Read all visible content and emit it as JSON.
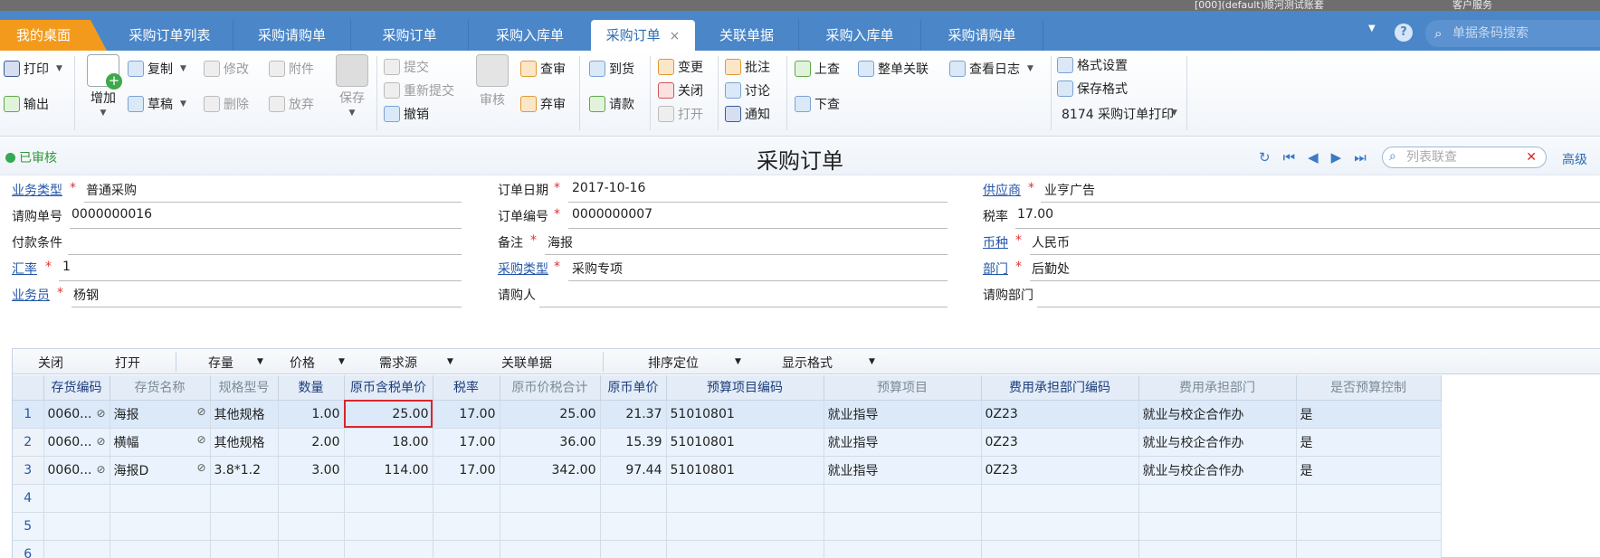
{
  "topbar": {
    "left_text": "[000](default)顺河测试账套",
    "user": "客户服务"
  },
  "tabs": [
    {
      "label": "我的桌面"
    },
    {
      "label": "采购订单列表"
    },
    {
      "label": "采购请购单"
    },
    {
      "label": "采购订单"
    },
    {
      "label": "采购入库单"
    },
    {
      "label": "采购订单",
      "close": "×"
    },
    {
      "label": "关联单据"
    },
    {
      "label": "采购入库单"
    },
    {
      "label": "采购请购单"
    }
  ],
  "search": {
    "placeholder": "单据条码搜索",
    "help": "?"
  },
  "toolbar": {
    "print": "打印",
    "export": "输出",
    "add": "增加",
    "copy": "复制",
    "draft": "草稿",
    "modify": "修改",
    "attach": "附件",
    "delete": "删除",
    "discard": "放弃",
    "save": "保存",
    "submit": "提交",
    "resubmit": "重新提交",
    "revoke": "撤销",
    "review": "审核",
    "check": "查审",
    "abandon": "弃审",
    "arrive": "到货",
    "request_pay": "请款",
    "change": "变更",
    "close": "关闭",
    "open": "打开",
    "annotate": "批注",
    "discuss": "讨论",
    "notify": "通知",
    "up_query": "上查",
    "down_query": "下查",
    "relate_all": "整单关联",
    "view_log": "查看日志",
    "format_setting": "格式设置",
    "save_format": "保存格式",
    "print_template": "8174 采购订单打印"
  },
  "titlebar": {
    "status": "已审核",
    "title": "采购订单",
    "list_search_placeholder": "列表联查",
    "advanced": "高级"
  },
  "form": {
    "biz_type_label": "业务类型",
    "biz_type": "普通采购",
    "req_no_label": "请购单号",
    "req_no": "0000000016",
    "pay_terms_label": "付款条件",
    "pay_terms": "",
    "rate_label": "汇率",
    "rate": "1",
    "staff_label": "业务员",
    "staff": "杨钢",
    "order_date_label": "订单日期",
    "order_date": "2017-10-16",
    "order_no_label": "订单编号",
    "order_no": "0000000007",
    "remark_label": "备注",
    "remark": "海报",
    "purchase_type_label": "采购类型",
    "purchase_type": "采购专项",
    "requester_label": "请购人",
    "requester": "",
    "supplier_label": "供应商",
    "supplier": "业亨广告",
    "tax_rate_label": "税率",
    "tax_rate": "17.00",
    "currency_label": "币种",
    "currency": "人民币",
    "dept_label": "部门",
    "dept": "后勤处",
    "req_dept_label": "请购部门",
    "req_dept": ""
  },
  "grid_toolbar": {
    "close": "关闭",
    "open": "打开",
    "stock": "存量",
    "price": "价格",
    "demand_source": "需求源",
    "related_docs": "关联单据",
    "sort_locate": "排序定位",
    "display_format": "显示格式"
  },
  "grid": {
    "columns": [
      "",
      "存货编码",
      "存货名称",
      "规格型号",
      "数量",
      "原币含税单价",
      "税率",
      "原币价税合计",
      "原币单价",
      "预算项目编码",
      "预算项目",
      "费用承担部门编码",
      "费用承担部门",
      "是否预算控制"
    ],
    "rows": [
      {
        "no": "1",
        "code": "0060...",
        "name": "海报",
        "spec": "其他规格",
        "qty": "1.00",
        "price_tax": "25.00",
        "tax": "17.00",
        "total": "25.00",
        "unit_price": "21.37",
        "budget_code": "51010801",
        "budget_item": "就业指导",
        "dept_code": "0Z23",
        "dept": "就业与校企合作办",
        "budget_ctrl": "是"
      },
      {
        "no": "2",
        "code": "0060...",
        "name": "横幅",
        "spec": "其他规格",
        "qty": "2.00",
        "price_tax": "18.00",
        "tax": "17.00",
        "total": "36.00",
        "unit_price": "15.39",
        "budget_code": "51010801",
        "budget_item": "就业指导",
        "dept_code": "0Z23",
        "dept": "就业与校企合作办",
        "budget_ctrl": "是"
      },
      {
        "no": "3",
        "code": "0060...",
        "name": "海报D",
        "spec": "3.8*1.2",
        "qty": "3.00",
        "price_tax": "114.00",
        "tax": "17.00",
        "total": "342.00",
        "unit_price": "97.44",
        "budget_code": "51010801",
        "budget_item": "就业指导",
        "dept_code": "0Z23",
        "dept": "就业与校企合作办",
        "budget_ctrl": "是"
      }
    ],
    "empty_rows": [
      "4",
      "5",
      "6"
    ]
  },
  "colors": {
    "tabbar": "#4a86c8",
    "home_tab": "#f39a1d",
    "highlight": "#d9262c",
    "approved": "#34a853"
  }
}
